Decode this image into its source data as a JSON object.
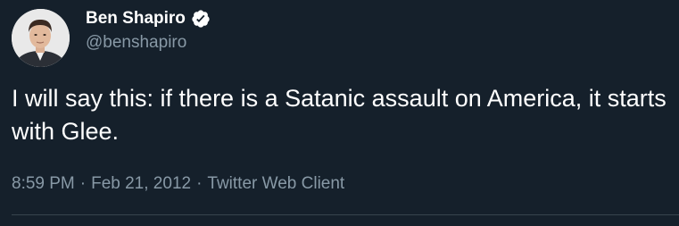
{
  "author": {
    "display_name": "Ben Shapiro",
    "handle": "@benshapiro",
    "verified": true,
    "verified_icon": "verified-badge-icon",
    "avatar_icon": "profile-photo"
  },
  "tweet": {
    "text": "I will say this: if there is a Satanic assault on America, it starts with Glee.",
    "time": "8:59 PM",
    "date": "Feb 21, 2012",
    "source": "Twitter Web Client",
    "separator": "·"
  },
  "colors": {
    "background": "#15202b",
    "primary_text": "#ffffff",
    "secondary_text": "#8899a6",
    "divider": "#38444d"
  }
}
